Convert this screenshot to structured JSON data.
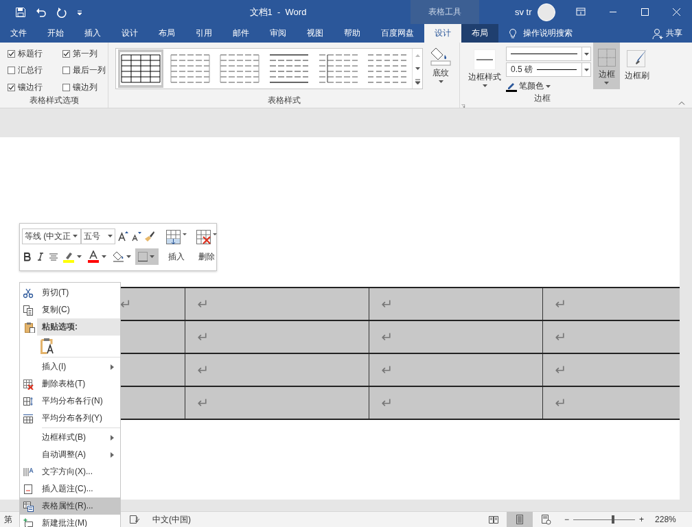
{
  "title_bar": {
    "title": "文档1  -  Word",
    "context_group": "表格工具",
    "user": "sv tr"
  },
  "ribbon_tabs": [
    {
      "label": "文件",
      "selected": false,
      "contextual": false
    },
    {
      "label": "开始",
      "selected": false,
      "contextual": false
    },
    {
      "label": "插入",
      "selected": false,
      "contextual": false
    },
    {
      "label": "设计",
      "selected": false,
      "contextual": false
    },
    {
      "label": "布局",
      "selected": false,
      "contextual": false
    },
    {
      "label": "引用",
      "selected": false,
      "contextual": false
    },
    {
      "label": "邮件",
      "selected": false,
      "contextual": false
    },
    {
      "label": "审阅",
      "selected": false,
      "contextual": false
    },
    {
      "label": "视图",
      "selected": false,
      "contextual": false
    },
    {
      "label": "帮助",
      "selected": false,
      "contextual": false
    },
    {
      "label": "百度网盘",
      "selected": false,
      "contextual": false
    },
    {
      "label": "设计",
      "selected": true,
      "contextual": true
    },
    {
      "label": "布局",
      "selected": false,
      "contextual": true
    }
  ],
  "tell_me": "操作说明搜索",
  "share": "共享",
  "ribbon": {
    "style_options": {
      "group_label": "表格样式选项",
      "items": [
        {
          "label": "标题行",
          "checked": true
        },
        {
          "label": "第一列",
          "checked": true
        },
        {
          "label": "汇总行",
          "checked": false
        },
        {
          "label": "最后一列",
          "checked": false
        },
        {
          "label": "镶边行",
          "checked": true
        },
        {
          "label": "镶边列",
          "checked": false
        }
      ]
    },
    "table_styles": {
      "group_label": "表格样式",
      "styles": [
        {
          "kind": "grid",
          "selected": true
        },
        {
          "kind": "dashed",
          "selected": false
        },
        {
          "kind": "dashed",
          "selected": false
        },
        {
          "kind": "lines",
          "selected": false
        },
        {
          "kind": "column",
          "selected": false
        },
        {
          "kind": "plain",
          "selected": false
        }
      ]
    },
    "shading": "底纹",
    "borders": {
      "group_label": "边框",
      "border_styles": "边框样式",
      "pen_weight": "0.5 磅",
      "pen_color": "笔颜色",
      "borders_button": {
        "label": "边框",
        "selected": true
      },
      "border_painter": "边框刷"
    }
  },
  "mini_toolbar": {
    "font": "等线 (中文正",
    "size": "五号",
    "insert": "插入",
    "delete": "删除",
    "border_selected": true
  },
  "table": {
    "selected": true,
    "rows": [
      [
        "↵",
        "↵",
        "↵",
        "↵"
      ],
      [
        "",
        "↵",
        "↵",
        "↵"
      ],
      [
        "",
        "↵",
        "↵",
        "↵"
      ],
      [
        "",
        "↵",
        "↵",
        "↵"
      ]
    ]
  },
  "context_menu": {
    "items": [
      {
        "kind": "command",
        "label": "剪切(T)",
        "selected": false
      },
      {
        "kind": "command",
        "label": "复制(C)",
        "selected": false
      },
      {
        "kind": "header",
        "label": "粘贴选项:"
      },
      {
        "kind": "paste_options"
      },
      {
        "kind": "separator"
      },
      {
        "kind": "submenu",
        "label": "插入(I)",
        "selected": false
      },
      {
        "kind": "command",
        "label": "删除表格(T)",
        "selected": false
      },
      {
        "kind": "command",
        "label": "平均分布各行(N)",
        "selected": false
      },
      {
        "kind": "command",
        "label": "平均分布各列(Y)",
        "selected": false
      },
      {
        "kind": "separator"
      },
      {
        "kind": "submenu",
        "label": "边框样式(B)",
        "selected": false
      },
      {
        "kind": "submenu",
        "label": "自动调整(A)",
        "selected": false
      },
      {
        "kind": "command",
        "label": "文字方向(X)...",
        "selected": false
      },
      {
        "kind": "command",
        "label": "插入题注(C)...",
        "selected": false
      },
      {
        "kind": "command",
        "label": "表格属性(R)...",
        "selected": true
      },
      {
        "kind": "command",
        "label": "新建批注(M)",
        "selected": false
      }
    ]
  },
  "status_bar": {
    "page": "第",
    "language": "中文(中国)",
    "views": [
      {
        "kind": "read",
        "selected": false
      },
      {
        "kind": "print",
        "selected": true
      },
      {
        "kind": "web",
        "selected": false
      }
    ],
    "zoom": {
      "minus": "−",
      "plus": "+",
      "level": 0.64,
      "percent": "228%"
    }
  }
}
